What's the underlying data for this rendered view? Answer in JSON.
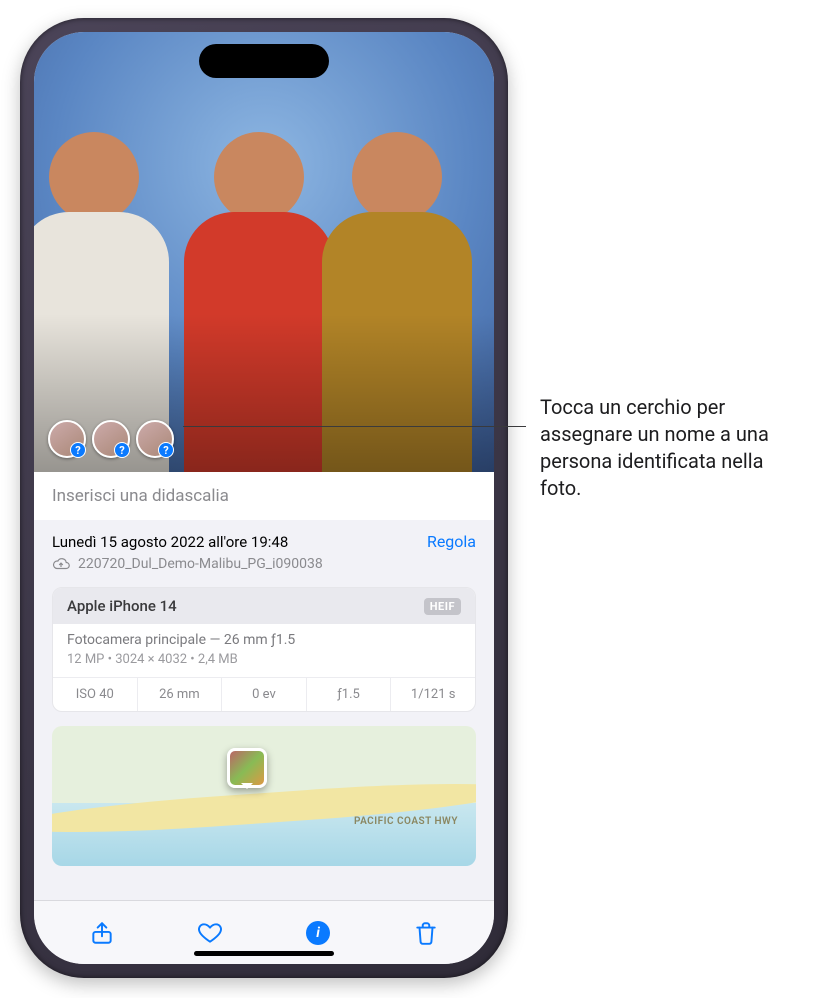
{
  "callout": "Tocca un cerchio per assegnare un nome a una persona identificata nella foto.",
  "caption_placeholder": "Inserisci una didascalia",
  "datetime": "Lunedì 15 agosto 2022 all'ore 19:48",
  "adjust_label": "Regola",
  "filename": "220720_Dul_Demo-Malibu_PG_i090038",
  "camera": {
    "device": "Apple iPhone 14",
    "format_badge": "HEIF",
    "lens_line": "Fotocamera principale — 26 mm ƒ1.5",
    "stats_line": "12 MP  •  3024 × 4032  •  2,4 MB",
    "cells": {
      "iso": "ISO 40",
      "focal": "26 mm",
      "ev": "0 ev",
      "aperture": "ƒ1.5",
      "shutter": "1/121 s"
    }
  },
  "map": {
    "highway_label": "PACIFIC COAST HWY"
  },
  "face_tags": [
    {
      "badge": "?"
    },
    {
      "badge": "?"
    },
    {
      "badge": "?"
    }
  ],
  "toolbar": {
    "share": "share",
    "favorite": "favorite",
    "info": "i",
    "delete": "delete"
  }
}
